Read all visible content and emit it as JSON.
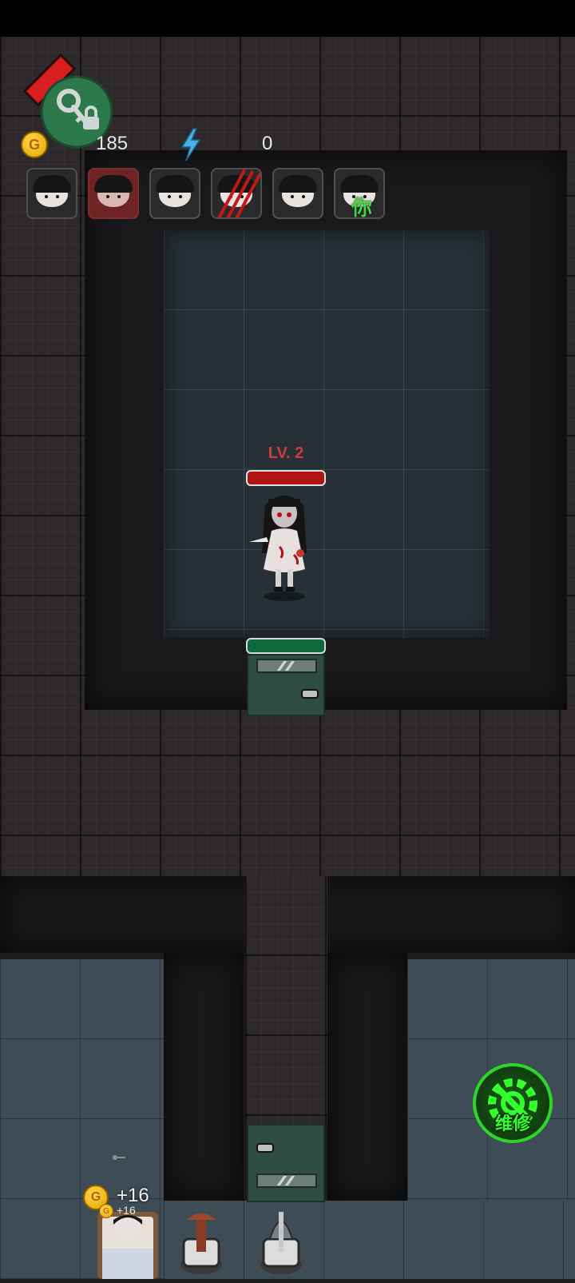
{
  "hud": {
    "coin_symbol": "G",
    "coins": "185",
    "energy": "0"
  },
  "portraits": [
    {
      "name": "ghost-girl",
      "status": "normal"
    },
    {
      "name": "red-girl",
      "status": "highlighted"
    },
    {
      "name": "boy",
      "status": "normal"
    },
    {
      "name": "scratched",
      "status": "attacked"
    },
    {
      "name": "girl-bangs",
      "status": "normal"
    },
    {
      "name": "player",
      "status": "you",
      "label": "你"
    }
  ],
  "enemy": {
    "level_label": "LV. 2",
    "hp_fraction": 1.0
  },
  "door": {
    "hp_fraction": 1.0
  },
  "repair_button": {
    "label": "维修"
  },
  "bed": {
    "coin_symbol": "G",
    "income": "+16",
    "income_small": "+16"
  },
  "colors": {
    "enemy_hp": "#b21414",
    "door_hp": "#0d6a3c",
    "repair_green": "#32ff2c",
    "coin_gold": "#ffc21a"
  }
}
